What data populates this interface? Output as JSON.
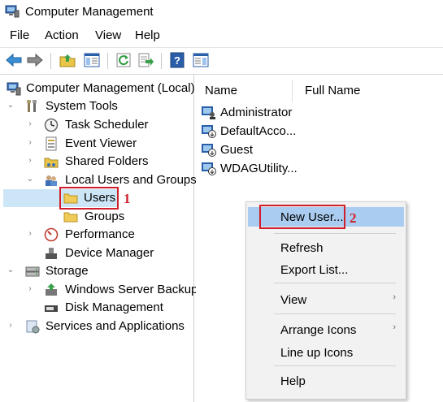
{
  "window": {
    "title": "Computer Management"
  },
  "menubar": [
    {
      "label": "File"
    },
    {
      "label": "Action"
    },
    {
      "label": "View"
    },
    {
      "label": "Help"
    }
  ],
  "toolbar": {
    "icons": [
      "back-arrow-icon",
      "forward-arrow-icon",
      "up-folder-icon",
      "show-hide-tree-icon",
      "refresh-icon",
      "export-list-icon",
      "help-icon",
      "show-action-pane-icon"
    ]
  },
  "tree": {
    "root": "Computer Management (Local)",
    "items": [
      {
        "label": "System Tools"
      },
      {
        "label": "Task Scheduler"
      },
      {
        "label": "Event Viewer"
      },
      {
        "label": "Shared Folders"
      },
      {
        "label": "Local Users and Groups"
      },
      {
        "label": "Users"
      },
      {
        "label": "Groups"
      },
      {
        "label": "Performance"
      },
      {
        "label": "Device Manager"
      },
      {
        "label": "Storage"
      },
      {
        "label": "Windows Server Backup"
      },
      {
        "label": "Disk Management"
      },
      {
        "label": "Services and Applications"
      }
    ]
  },
  "list": {
    "columns": [
      "Name",
      "Full Name"
    ],
    "rows": [
      {
        "name": "Administrator"
      },
      {
        "name": "DefaultAcco..."
      },
      {
        "name": "Guest"
      },
      {
        "name": "WDAGUtility..."
      }
    ]
  },
  "context_menu": {
    "items": [
      {
        "label": "New User..."
      },
      {
        "label": "Refresh"
      },
      {
        "label": "Export List..."
      },
      {
        "label": "View"
      },
      {
        "label": "Arrange Icons"
      },
      {
        "label": "Line up Icons"
      },
      {
        "label": "Help"
      }
    ],
    "submenu_glyph": "›"
  },
  "annotations": {
    "step1": "1",
    "step2": "2",
    "color": "#d01f2a"
  },
  "colors": {
    "highlight": "#a9ccf0",
    "menu_bg": "#f2f2f2"
  }
}
